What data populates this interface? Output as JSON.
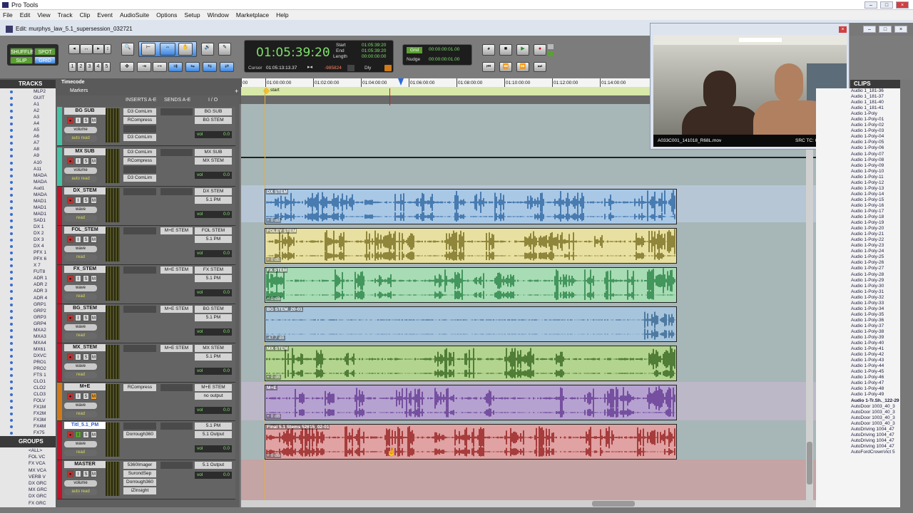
{
  "app": {
    "title": "Pro Tools"
  },
  "menu": [
    "File",
    "Edit",
    "View",
    "Track",
    "Clip",
    "Event",
    "AudioSuite",
    "Options",
    "Setup",
    "Window",
    "Marketplace",
    "Help"
  ],
  "edit_window": {
    "title": "Edit: murphys_law_5.1_supersession_032721"
  },
  "modes": {
    "shuffle": "SHUFFLE",
    "spot": "SPOT",
    "slip": "SLIP",
    "grid": "GRID"
  },
  "zoom_presets": [
    "1",
    "2",
    "3",
    "4",
    "5"
  ],
  "counter": {
    "main": "01:05:39:20",
    "cursor_label": "Cursor",
    "cursor": "01:05:13:13.37",
    "sample": "-985824",
    "dly": "Dly",
    "start_label": "Start",
    "end_label": "End",
    "length_label": "Length",
    "start": "01:05:39:20",
    "end": "01:05:39:20",
    "length": "00:00:00:00"
  },
  "grid": {
    "grid_label": "Grid",
    "grid_value": "00:00:00:01.00",
    "nudge_label": "Nudge",
    "nudge_value": "00:00:00:01.00"
  },
  "rulers": {
    "timecode_label": "Timecode",
    "markers_label": "Markers",
    "start_marker": "start",
    "ticks": [
      "00",
      "01:00:00:00",
      "01:02:00:00",
      "01:04:00:00",
      "01:06:00:00",
      "01:08:00:00",
      "01:10:00:00",
      "01:12:00:00",
      "01:14:00:00"
    ]
  },
  "columns": {
    "inserts": "INSERTS A-E",
    "sends": "SENDS A-E",
    "io": "I / O"
  },
  "tracks_panel": {
    "title": "TRACKS",
    "items": [
      "MLP2",
      "GUIT",
      "A1",
      "A2",
      "A3",
      "A4",
      "A5",
      "A6",
      "A7",
      "A8",
      "A9",
      "A10",
      "A11",
      "MADA",
      "MADA",
      "Aud1",
      "MADA",
      "MAD1",
      "MAD1",
      "MAD1",
      "SAD1",
      "DX 1",
      "DX 2",
      "DX 3",
      "DX 4",
      "PFX 1",
      "PFX 6",
      "X 7",
      "FUT8",
      "ADR 1",
      "ADR 2",
      "ADR 3",
      "ADR 4",
      "GRP1",
      "GRP2",
      "GRP3",
      "GRP4",
      "MXA2",
      "MXA3",
      "MXA4",
      "MX61",
      "DXVC",
      "PRO1",
      "PRO2",
      "FTS 1",
      "CLO1",
      "CLO2",
      "CLO3",
      "FOLV",
      "FX1M",
      "FX2M",
      "FX3M",
      "FX4M",
      "FX75"
    ]
  },
  "groups_panel": {
    "title": "GROUPS",
    "items": [
      "<ALL>",
      "FOL VC",
      "FX VCA",
      "MX VCA",
      "VERB V",
      "DX GRC",
      "MX GRC",
      "DX GRC",
      "FX GRC"
    ]
  },
  "mix_tracks": [
    {
      "name": "BG SUB",
      "color": "#44c4a4",
      "mode": "volume",
      "auto": "auto read",
      "inserts": [
        "D3 ComLim",
        "RCompress",
        "",
        "D3 ComLim"
      ],
      "io_in": "BG SUB",
      "io_out": "BG STEM",
      "vol_label": "vol",
      "vol": "0.0",
      "send": ""
    },
    {
      "name": "MX SUB",
      "color": "#44c4a4",
      "mode": "volume",
      "auto": "auto read",
      "inserts": [
        "D3 ComLim",
        "RCompress",
        "",
        "D3 ComLim"
      ],
      "io_in": "MX SUB",
      "io_out": "MX STEM",
      "vol_label": "vol",
      "vol": "0.0",
      "send": ""
    },
    {
      "name": "DX_STEM",
      "color": "#c0142a",
      "mode": "wave",
      "auto": "read",
      "inserts": [],
      "io_in": "DX STEM",
      "io_out": "5.1 PM",
      "vol_label": "vol",
      "vol": "0.0",
      "send": ""
    },
    {
      "name": "FOL_STEM",
      "color": "#c0142a",
      "mode": "wave",
      "auto": "read",
      "inserts": [],
      "io_in": "FOL STEM",
      "io_out": "5.1 PM",
      "vol_label": "vol",
      "vol": "0.0",
      "send": "M+E STEM"
    },
    {
      "name": "FX_STEM",
      "color": "#c0142a",
      "mode": "wave",
      "auto": "read",
      "inserts": [],
      "io_in": "FX STEM",
      "io_out": "5.1 PM",
      "vol_label": "vol",
      "vol": "0.0",
      "send": "M+E STEM"
    },
    {
      "name": "BG_STEM",
      "color": "#c0142a",
      "mode": "wave",
      "auto": "read",
      "inserts": [],
      "io_in": "BG STEM",
      "io_out": "5.1 PM",
      "vol_label": "vol",
      "vol": "0.0",
      "send": "M+E STEM"
    },
    {
      "name": "MX_STEM",
      "color": "#c0142a",
      "mode": "wave",
      "auto": "read",
      "inserts": [],
      "io_in": "MX STEM",
      "io_out": "5.1 PM",
      "vol_label": "vol",
      "vol": "0.0",
      "send": "M+E STEM"
    },
    {
      "name": "M+E",
      "color": "#d07a18",
      "mode": "wave",
      "auto": "read",
      "inserts": [
        "RCompress"
      ],
      "io_in": "M+E STEM",
      "io_out": "no output",
      "vol_label": "vol",
      "vol": "0.0",
      "send": ""
    },
    {
      "name": "Titl_5.1_PM",
      "color": "#c0142a",
      "mode": "wave",
      "auto": "read",
      "inserts": [
        "",
        "Dorrough360"
      ],
      "io_in": "5.1 PM",
      "io_out": "5.1 Output",
      "vol_label": "vol",
      "vol": "0.0",
      "send": ""
    },
    {
      "name": "MASTER",
      "color": "#c0142a",
      "mode": "volume",
      "auto": "auto read",
      "inserts": [
        "5360Imager",
        "SurondSep",
        "Dorrough360",
        "iZInsight"
      ],
      "io_in": "5.1 Output",
      "io_out": "",
      "vol_label": "vol",
      "vol": "0.0",
      "send": ""
    }
  ],
  "regions": [
    {
      "name": "DX STEM",
      "db": "+ 0 dB",
      "bg": "#a9c8e6",
      "wave": "#1e5a98"
    },
    {
      "name": "FOLEY STEM",
      "db": "+ 0 dB",
      "bg": "#e8e0a0",
      "wave": "#6a6010"
    },
    {
      "name": "FX STEM",
      "db": "+ 0 dB",
      "bg": "#a8dcb4",
      "wave": "#187838"
    },
    {
      "name": "BG STEM_20-01",
      "db": "-47.7 dB",
      "bg": "#a6c4dc",
      "wave": "#285a88"
    },
    {
      "name": "MX STEM",
      "db": "+ 0 dB",
      "bg": "#b2d48e",
      "wave": "#275812"
    },
    {
      "name": "M+E",
      "db": "+ 0 dB",
      "bg": "#b6a2d0",
      "wave": "#5a2c8c"
    },
    {
      "name": "Final 5.1 Stems 52615_02-01",
      "db": "+ 0 dB",
      "bg": "#e0a2a2",
      "wave": "#8e1010"
    }
  ],
  "video": {
    "filename": "A033C001_141018_R68L.mov",
    "src_tc": "SRC TC: 01:04:08:13"
  },
  "clips_panel": {
    "title": "CLIPS",
    "items": [
      "Audio 1_181-36",
      "Audio 1_181-37",
      "Audio 1_181-40",
      "Audio 1_181-41",
      "Audio 1-Poly",
      "Audio 1-Poly-01",
      "Audio 1-Poly-02",
      "Audio 1-Poly-03",
      "Audio 1-Poly-04",
      "Audio 1-Poly-05",
      "Audio 1-Poly-06",
      "Audio 1-Poly-07",
      "Audio 1-Poly-08",
      "Audio 1-Poly-09",
      "Audio 1-Poly-10",
      "Audio 1-Poly-11",
      "Audio 1-Poly-12",
      "Audio 1-Poly-13",
      "Audio 1-Poly-14",
      "Audio 1-Poly-15",
      "Audio 1-Poly-16",
      "Audio 1-Poly-17",
      "Audio 1-Poly-18",
      "Audio 1-Poly-19",
      "Audio 1-Poly-20",
      "Audio 1-Poly-21",
      "Audio 1-Poly-22",
      "Audio 1-Poly-23",
      "Audio 1-Poly-24",
      "Audio 1-Poly-25",
      "Audio 1-Poly-26",
      "Audio 1-Poly-27",
      "Audio 1-Poly-28",
      "Audio 1-Poly-29",
      "Audio 1-Poly-30",
      "Audio 1-Poly-31",
      "Audio 1-Poly-32",
      "Audio 1-Poly-33",
      "Audio 1-Poly-34",
      "Audio 1-Poly-35",
      "Audio 1-Poly-36",
      "Audio 1-Poly-37",
      "Audio 1-Poly-38",
      "Audio 1-Poly-39",
      "Audio 1-Poly-40",
      "Audio 1-Poly-41",
      "Audio 1-Poly-42",
      "Audio 1-Poly-43",
      "Audio 1-Poly-44",
      "Audio 1-Poly-45",
      "Audio 1-Poly-46",
      "Audio 1-Poly-47",
      "Audio 1-Poly-48",
      "Audio 1-Poly-49",
      "Audio 1-Tr.Sh._122-29",
      "AutoDoor 1003_40_3",
      "AutoDoor 1003_40_3",
      "AutoDoor 1003_40_3",
      "AutoDoor 1003_40_3",
      "AutoDriving 1004_47",
      "AutoDriving 1004_47",
      "AutoDriving 1004_47",
      "AutoDriving 1004_47",
      "AutoFordCrownVict 5"
    ],
    "bold_index": 54
  }
}
